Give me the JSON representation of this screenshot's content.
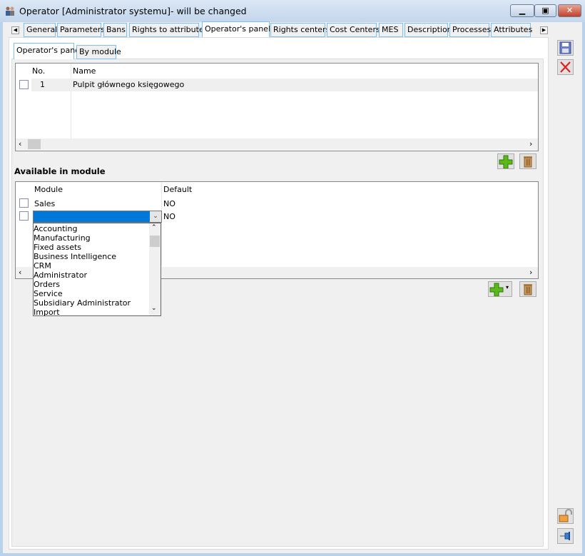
{
  "window": {
    "title": "Operator [Administrator systemu]- will be changed"
  },
  "tabs": [
    "General",
    "Parameters",
    "Bans",
    "Rights to attributes",
    "Operator's panels",
    "Rights centers",
    "Cost Centers",
    "MES",
    "Description",
    "Processes",
    "Attributes"
  ],
  "active_tab": "Operator's panels",
  "subtabs": [
    "Operator's panel",
    "By module"
  ],
  "panels_grid": {
    "columns": [
      "No.",
      "Name"
    ],
    "rows": [
      {
        "no": "1",
        "name": "Pulpit głównego księgowego"
      }
    ]
  },
  "module_section": {
    "title": "Available in module",
    "columns": [
      "Module",
      "Default"
    ],
    "rows": [
      {
        "module": "Sales",
        "default": "NO"
      },
      {
        "module": "",
        "default": "NO"
      }
    ]
  },
  "dropdown_options": [
    "Accounting",
    "Manufacturing",
    "Fixed assets",
    "Business Intelligence",
    "CRM",
    "Administrator",
    "Orders",
    "Service",
    "Subsidiary Administrator",
    "Import"
  ],
  "colors": {
    "selection": "#0078d7",
    "tab_border": "#7fc0f2",
    "add_green": "#5bb81b",
    "trash": "#b5854a",
    "cancel_red": "#e02020"
  }
}
